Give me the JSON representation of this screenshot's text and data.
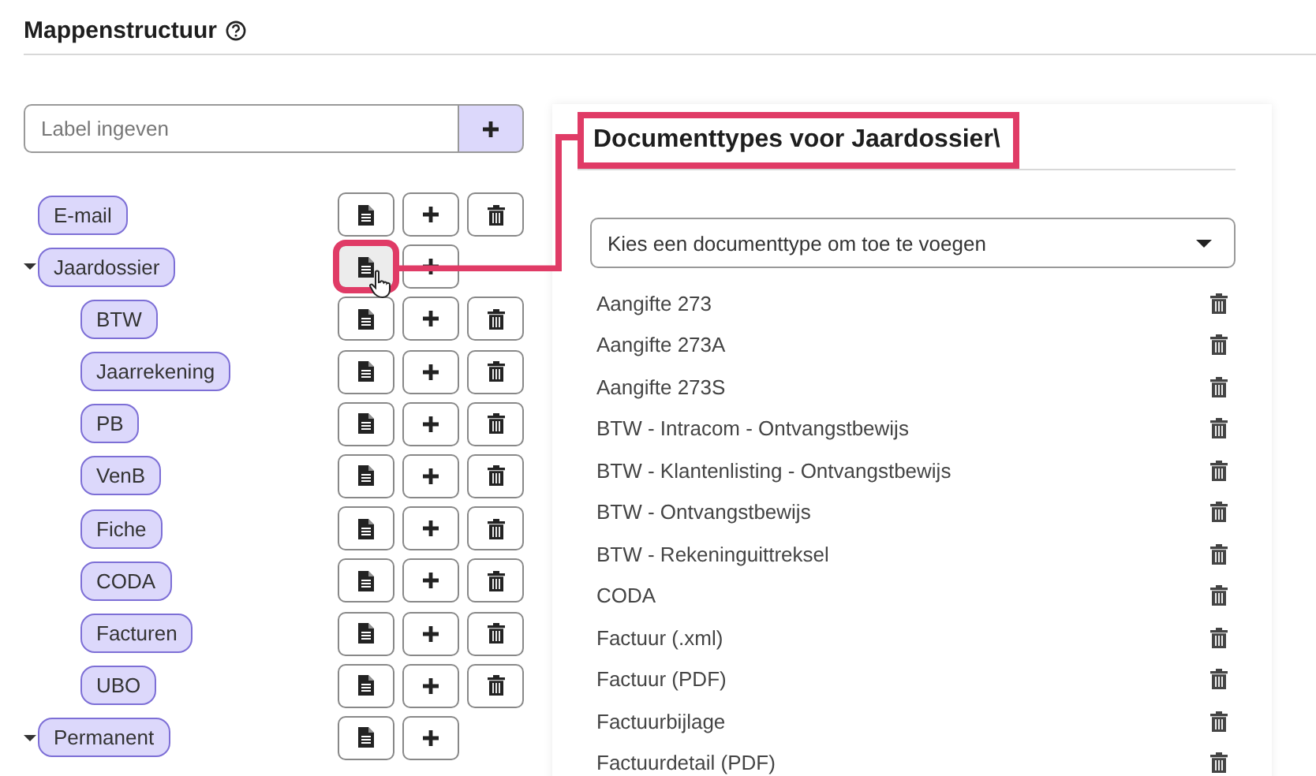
{
  "heading": {
    "title": "Mappenstructuur"
  },
  "label_input": {
    "placeholder": "Label ingeven"
  },
  "tree": [
    {
      "label": "E-mail",
      "deletable": true,
      "highlighted": false
    },
    {
      "label": "Jaardossier",
      "deletable": false,
      "highlighted": true,
      "expanded": true,
      "children": [
        {
          "label": "BTW",
          "deletable": true,
          "highlighted": false
        },
        {
          "label": "Jaarrekening",
          "deletable": true,
          "highlighted": false
        },
        {
          "label": "PB",
          "deletable": true,
          "highlighted": false
        },
        {
          "label": "VenB",
          "deletable": true,
          "highlighted": false
        },
        {
          "label": "Fiche",
          "deletable": true,
          "highlighted": false
        },
        {
          "label": "CODA",
          "deletable": true,
          "highlighted": false
        },
        {
          "label": "Facturen",
          "deletable": true,
          "highlighted": false
        },
        {
          "label": "UBO",
          "deletable": true,
          "highlighted": false
        }
      ]
    },
    {
      "label": "Permanent",
      "deletable": false,
      "highlighted": false,
      "expanded": true
    }
  ],
  "panel": {
    "title": "Documenttypes voor Jaardossier\\",
    "select": {
      "placeholder": "Kies een documenttype om toe te voegen"
    },
    "items": [
      "Aangifte 273",
      "Aangifte 273A",
      "Aangifte 273S",
      "BTW - Intracom - Ontvangstbewijs",
      "BTW - Klantenlisting - Ontvangstbewijs",
      "BTW - Ontvangstbewijs",
      "BTW - Rekeninguittreksel",
      "CODA",
      "Factuur (.xml)",
      "Factuur (PDF)",
      "Factuurbijlage",
      "Factuurdetail (PDF)"
    ]
  }
}
